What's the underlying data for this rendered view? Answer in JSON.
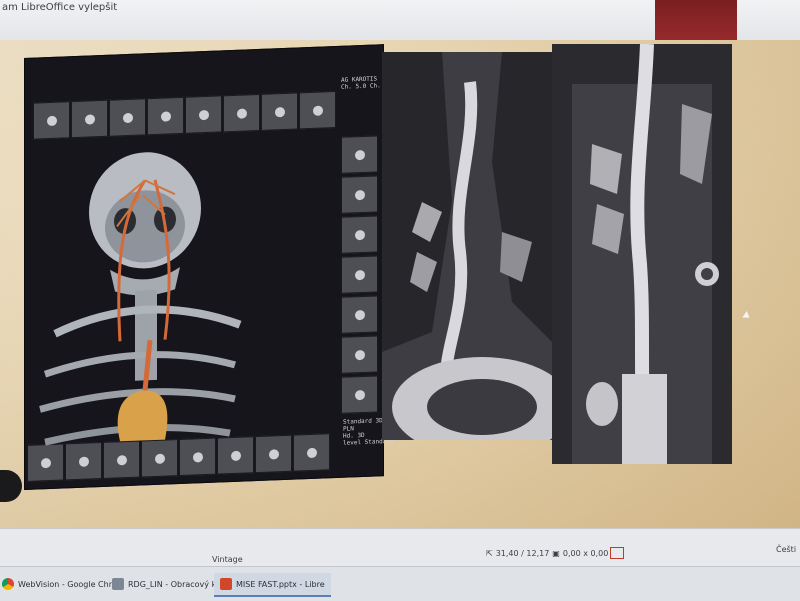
{
  "window": {
    "title": "am LibreOffice vylepšit"
  },
  "viewer": {
    "overlay_top_right": "AG KAROTIS\nCh. 5.0 Ch.",
    "overlay_bottom": "Standard 3D\nPLN\nHd. 3D\nlevel Standard"
  },
  "statusbar": {
    "slide_design": "Vintage",
    "position": "31,40 / 12,17",
    "size": "0,00 x 0,00",
    "language": "Češti"
  },
  "taskbar": {
    "items": [
      {
        "label": "WebVision - Google Chr",
        "icon": "chrome-icon"
      },
      {
        "label": "RDG_LIN - Obracový ko",
        "icon": "app-icon"
      },
      {
        "label": "MISE FAST.pptx - Libre",
        "icon": "impress-icon"
      }
    ]
  }
}
